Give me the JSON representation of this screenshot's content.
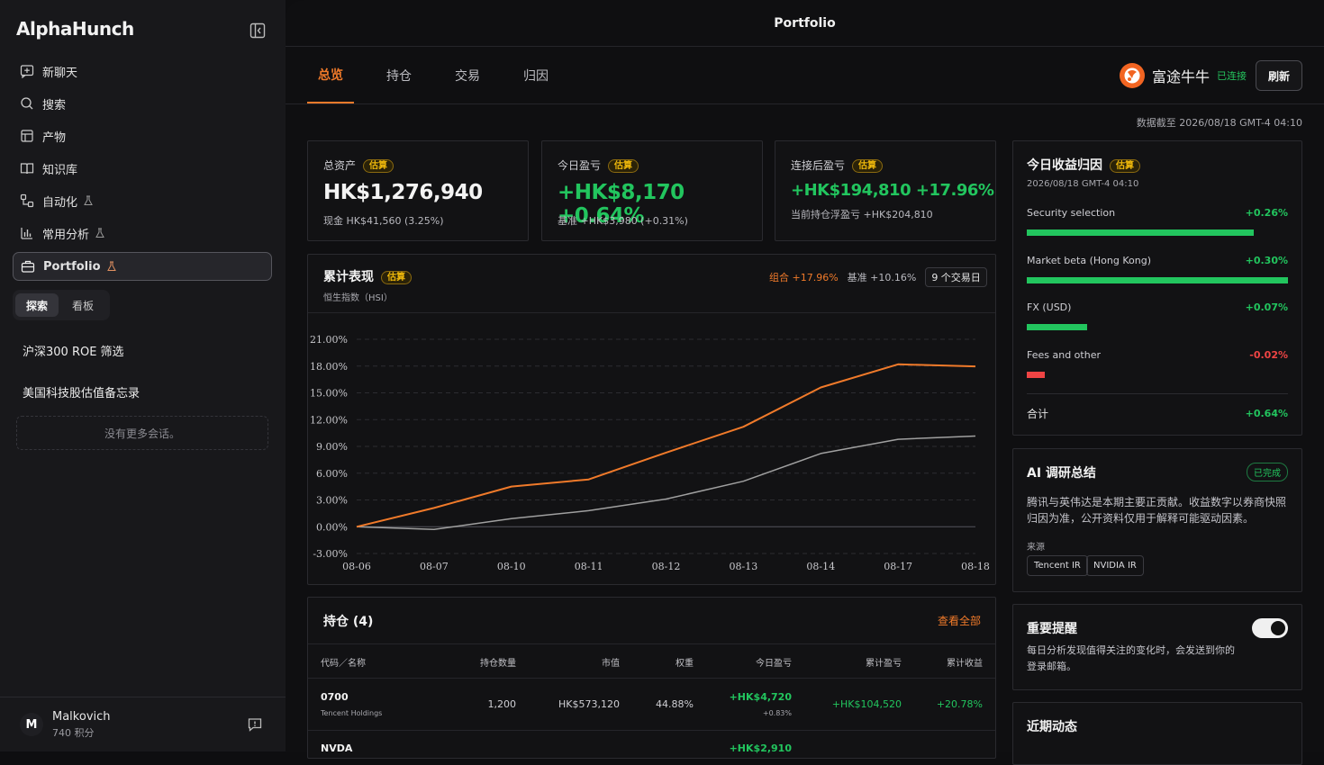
{
  "app": {
    "logo": "AlphaHunch",
    "page_title": "Portfolio"
  },
  "sidebar": {
    "items": [
      {
        "label": "新聊天",
        "icon": "new-chat-icon"
      },
      {
        "label": "搜索",
        "icon": "search-icon"
      },
      {
        "label": "产物",
        "icon": "artifact-icon"
      },
      {
        "label": "知识库",
        "icon": "book-icon"
      },
      {
        "label": "自动化",
        "icon": "automation-icon",
        "beta": true
      },
      {
        "label": "常用分析",
        "icon": "bar-chart-icon",
        "beta": true
      },
      {
        "label": "Portfolio",
        "icon": "briefcase-icon",
        "beta": true,
        "active": true
      }
    ],
    "segments": {
      "active": "探索",
      "inactive": "看板"
    },
    "conversations": [
      "沪深300 ROE 筛选",
      "美国科技股估值备忘录"
    ],
    "no_more": "没有更多会话。",
    "user": {
      "initial": "M",
      "name": "Malkovich",
      "points": "740 积分"
    }
  },
  "tabs": [
    "总览",
    "持仓",
    "交易",
    "归因"
  ],
  "broker": {
    "name": "富途牛牛",
    "status": "已连接"
  },
  "refresh_label": "刷新",
  "as_of": "数据截至 2026/08/18 GMT-4 04:10",
  "estimate_badge": "估算",
  "kpis": [
    {
      "label": "总资产",
      "value": "HK$1,276,940",
      "sub": "现金 HK$41,560 (3.25%)",
      "tone": "neutral"
    },
    {
      "label": "今日盈亏",
      "value": "+HK$8,170 +0.64%",
      "sub": "基准 +HK$3,980 (+0.31%)",
      "tone": "green"
    },
    {
      "label": "连接后盈亏",
      "value": "+HK$194,810 +17.96%",
      "sub": "当前持仓浮盈亏 +HK$204,810",
      "tone": "green"
    }
  ],
  "performance": {
    "title": "累计表现",
    "subtitle": "恒生指数（HSI）",
    "legend_portfolio": "组合 +17.96%",
    "legend_benchmark": "基准 +10.16%",
    "days": "9 个交易日"
  },
  "chart_data": {
    "type": "line",
    "x": [
      "08-06",
      "08-07",
      "08-10",
      "08-11",
      "08-12",
      "08-13",
      "08-14",
      "08-17",
      "08-18"
    ],
    "yticks": [
      "21.00%",
      "18.00%",
      "15.00%",
      "12.00%",
      "9.00%",
      "6.00%",
      "3.00%",
      "0.00%",
      "-3.00%"
    ],
    "ylim": [
      -3,
      21
    ],
    "series": [
      {
        "name": "组合",
        "color": "#f07a2a",
        "values": [
          0.0,
          2.1,
          4.5,
          5.3,
          8.3,
          11.2,
          15.6,
          18.2,
          17.96
        ]
      },
      {
        "name": "基准",
        "color": "#a0a0a0",
        "values": [
          0.0,
          -0.3,
          0.9,
          1.8,
          3.1,
          5.1,
          8.2,
          9.8,
          10.16
        ]
      }
    ]
  },
  "holdings": {
    "title": "持仓 (4)",
    "view_all": "查看全部",
    "columns": [
      "代码／名称",
      "持仓数量",
      "市值",
      "权重",
      "今日盈亏",
      "累计盈亏",
      "累计收益"
    ],
    "rows": [
      {
        "ticker": "0700",
        "name": "Tencent Holdings",
        "qty": "1,200",
        "mv": "HK$573,120",
        "weight": "44.88%",
        "today": "+HK$4,720",
        "today_pct": "+0.83%",
        "cum": "+HK$104,520",
        "ret": "+20.78%"
      },
      {
        "ticker": "NVDA",
        "today": "+HK$2,910"
      }
    ]
  },
  "attribution": {
    "title": "今日收益归因",
    "date": "2026/08/18 GMT-4 04:10",
    "items": [
      {
        "name": "Security selection",
        "value": "+0.26%",
        "level": 0.87,
        "color": "#22c55e"
      },
      {
        "name": "Market beta (Hong Kong)",
        "value": "+0.30%",
        "level": 1.0,
        "color": "#22c55e"
      },
      {
        "name": "FX (USD)",
        "value": "+0.07%",
        "level": 0.23,
        "color": "#22c55e"
      },
      {
        "name": "Fees and other",
        "value": "-0.02%",
        "level": 0.07,
        "color": "#ef4444"
      }
    ],
    "total_label": "合计",
    "total_value": "+0.64%"
  },
  "ai_summary": {
    "title": "AI 调研总结",
    "status": "已完成",
    "text": "腾讯与英伟达是本期主要正贡献。收益数字以券商快照归因为准，公开资料仅用于解释可能驱动因素。",
    "source_label": "来源",
    "sources": [
      "Tencent IR",
      "NVIDIA IR"
    ]
  },
  "alert": {
    "title": "重要提醒",
    "text": "每日分析发现值得关注的变化时，会发送到你的登录邮箱。",
    "enabled": true
  },
  "recent": {
    "title": "近期动态"
  }
}
